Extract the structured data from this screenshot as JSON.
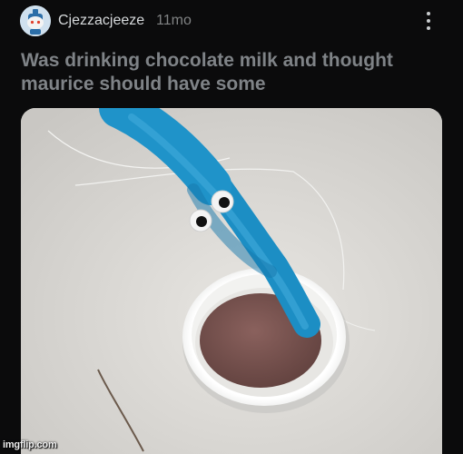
{
  "post": {
    "author": "Cjezzacjeeze",
    "age": "11mo",
    "title": "Was drinking chocolate milk and thought maurice should have some"
  },
  "icons": {
    "avatar": "snoo-avatar-icon",
    "menu": "more-vertical-icon"
  },
  "colors": {
    "background": "#0b0b0c",
    "title": "#7f8387",
    "username": "#d7dadc",
    "pipe_cleaner": "#1f93c9",
    "chocolate_milk": "#7c5451",
    "bottle_cap": "#f6f6f4"
  },
  "watermark": "imgflip.com"
}
